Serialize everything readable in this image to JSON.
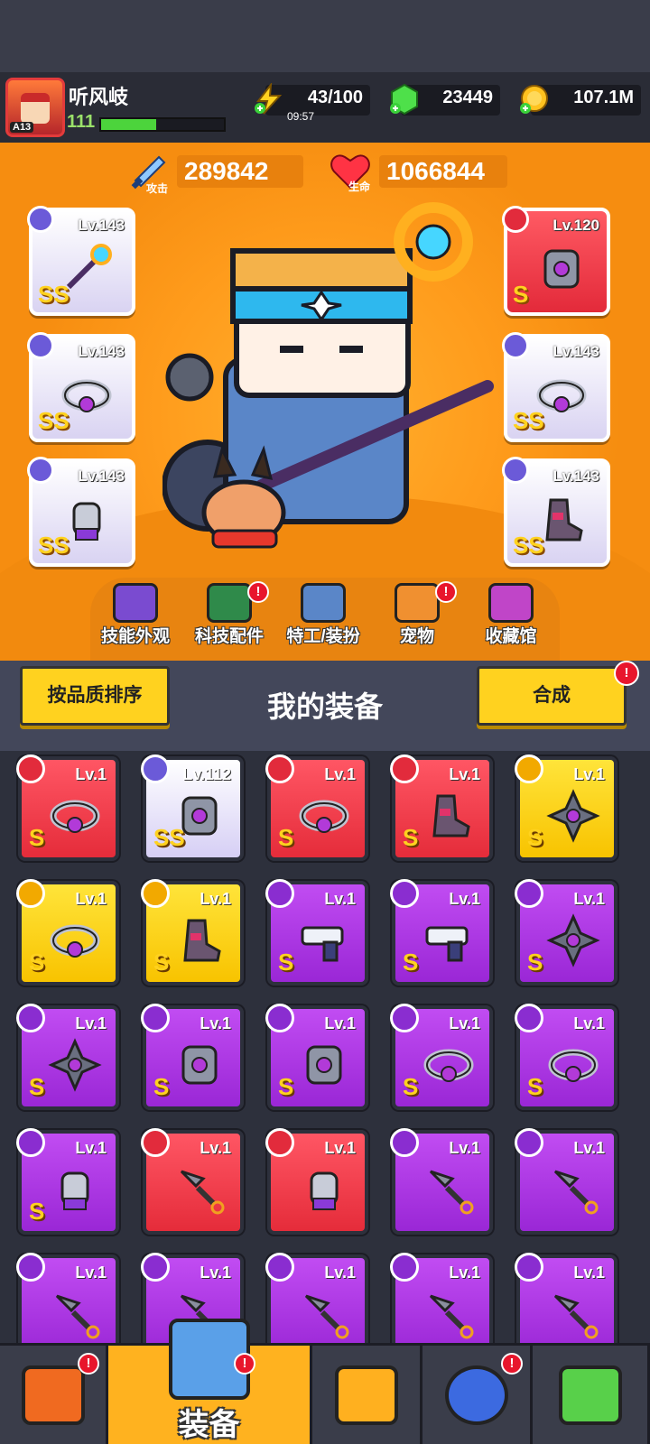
{
  "player": {
    "name": "听风岐",
    "level": "111",
    "avatar_badge": "A13",
    "xp_fraction": 0.45
  },
  "resources": {
    "energy": {
      "value": "43/100",
      "timer": "09:57",
      "icon": "lightning-icon"
    },
    "gems": {
      "value": "23449",
      "icon": "gem-icon"
    },
    "coins": {
      "value": "107.1M",
      "icon": "coin-icon"
    }
  },
  "stats": {
    "attack": {
      "label": "攻击",
      "value": "289842",
      "icon": "sword-icon"
    },
    "health": {
      "label": "生命",
      "value": "1066844",
      "icon": "heart-icon"
    }
  },
  "equipped": {
    "left": [
      {
        "level": "Lv.143",
        "rank": "SS",
        "slot_icon": "weapon-slot-icon",
        "art": "staff-icon"
      },
      {
        "level": "Lv.143",
        "rank": "SS",
        "slot_icon": "necklace-slot-icon",
        "art": "necklace-icon"
      },
      {
        "level": "Lv.143",
        "rank": "SS",
        "slot_icon": "glove-slot-icon",
        "art": "glove-icon"
      }
    ],
    "right": [
      {
        "level": "Lv.120",
        "rank": "S",
        "slot_icon": "armor-slot-icon",
        "art": "armor-icon"
      },
      {
        "level": "Lv.143",
        "rank": "SS",
        "slot_icon": "ring-slot-icon",
        "art": "ring-icon"
      },
      {
        "level": "Lv.143",
        "rank": "SS",
        "slot_icon": "boot-slot-icon",
        "art": "boot-icon"
      }
    ]
  },
  "tabs": [
    {
      "label": "技能外观",
      "icon": "skill-skin-icon",
      "badge": false
    },
    {
      "label": "科技配件",
      "icon": "tech-part-icon",
      "badge": true
    },
    {
      "label": "特工/装扮",
      "icon": "agent-outfit-icon",
      "badge": false
    },
    {
      "label": "宠物",
      "icon": "pet-icon",
      "badge": true
    },
    {
      "label": "收藏馆",
      "icon": "collection-icon",
      "badge": false
    }
  ],
  "equipment_panel": {
    "title": "我的装备",
    "sort_label": "按品质排序",
    "merge_label": "合成",
    "merge_badge": "!"
  },
  "inventory": [
    {
      "level": "Lv.1",
      "rank": "S",
      "color": "red",
      "art": "necklace-icon"
    },
    {
      "level": "Lv.112",
      "rank": "SS",
      "color": "white",
      "art": "armor-icon"
    },
    {
      "level": "Lv.1",
      "rank": "S",
      "color": "red",
      "art": "ring-icon"
    },
    {
      "level": "Lv.1",
      "rank": "S",
      "color": "red",
      "art": "boot-icon"
    },
    {
      "level": "Lv.1",
      "rank": "S",
      "color": "yellow",
      "art": "shuriken-icon"
    },
    {
      "level": "Lv.1",
      "rank": "S",
      "color": "yellow",
      "art": "necklace-icon"
    },
    {
      "level": "Lv.1",
      "rank": "S",
      "color": "yellow",
      "art": "boot-icon"
    },
    {
      "level": "Lv.1",
      "rank": "S",
      "color": "purple",
      "art": "gun-icon"
    },
    {
      "level": "Lv.1",
      "rank": "S",
      "color": "purple",
      "art": "gun-icon"
    },
    {
      "level": "Lv.1",
      "rank": "S",
      "color": "purple",
      "art": "shuriken-icon"
    },
    {
      "level": "Lv.1",
      "rank": "S",
      "color": "purple",
      "art": "shuriken-icon"
    },
    {
      "level": "Lv.1",
      "rank": "S",
      "color": "purple",
      "art": "armor-icon"
    },
    {
      "level": "Lv.1",
      "rank": "S",
      "color": "purple",
      "art": "armor-icon"
    },
    {
      "level": "Lv.1",
      "rank": "S",
      "color": "purple",
      "art": "ring-icon"
    },
    {
      "level": "Lv.1",
      "rank": "S",
      "color": "purple",
      "art": "ring-icon"
    },
    {
      "level": "Lv.1",
      "rank": "S",
      "color": "purple",
      "art": "glove-icon"
    },
    {
      "level": "Lv.1",
      "rank": "",
      "color": "red",
      "art": "kunai-icon"
    },
    {
      "level": "Lv.1",
      "rank": "",
      "color": "red",
      "art": "glove-icon"
    },
    {
      "level": "Lv.1",
      "rank": "",
      "color": "purple",
      "art": "kunai-icon"
    },
    {
      "level": "Lv.1",
      "rank": "",
      "color": "purple",
      "art": "kunai-icon"
    },
    {
      "level": "Lv.1",
      "rank": "",
      "color": "purple",
      "art": "kunai-icon"
    },
    {
      "level": "Lv.1",
      "rank": "",
      "color": "purple",
      "art": "kunai-icon"
    },
    {
      "level": "Lv.1",
      "rank": "",
      "color": "purple",
      "art": "kunai-icon"
    },
    {
      "level": "Lv.1",
      "rank": "",
      "color": "purple",
      "art": "kunai-icon"
    },
    {
      "level": "Lv.1",
      "rank": "",
      "color": "purple",
      "art": "kunai-icon"
    }
  ],
  "nav": [
    {
      "name": "nav-shop",
      "icon": "shop-icon",
      "label": "",
      "badge": true
    },
    {
      "name": "nav-equipment",
      "icon": "equipment-icon",
      "label": "装备",
      "badge": true
    },
    {
      "name": "nav-battle",
      "icon": "battle-star-icon",
      "label": "",
      "badge": false
    },
    {
      "name": "nav-planet",
      "icon": "planet-icon",
      "label": "",
      "badge": true
    },
    {
      "name": "nav-lab",
      "icon": "dna-icon",
      "label": "",
      "badge": false
    }
  ],
  "colors": {
    "accent_yellow": "#ffd21f",
    "hero_orange": "#ff9c1c",
    "badge_red": "#e8162c",
    "panel": "#43475a"
  }
}
